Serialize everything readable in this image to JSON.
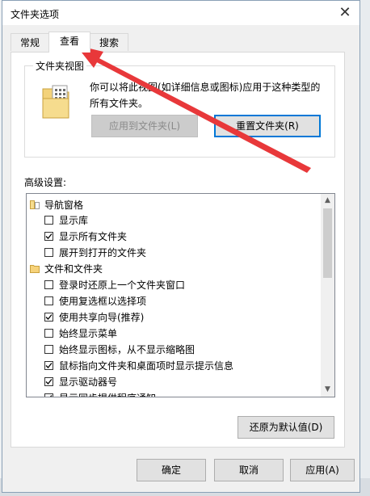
{
  "dialog": {
    "title": "文件夹选项",
    "close_glyph": "✕"
  },
  "tabs": [
    {
      "label": "常规",
      "active": false
    },
    {
      "label": "查看",
      "active": true
    },
    {
      "label": "搜索",
      "active": false
    }
  ],
  "folder_views": {
    "legend": "文件夹视图",
    "description": "你可以将此视图(如详细信息或图标)应用于这种类型的所有文件夹。",
    "apply_button": "应用到文件夹(L)",
    "reset_button": "重置文件夹(R)"
  },
  "advanced": {
    "label": "高级设置:",
    "items": [
      {
        "type": "folder",
        "label": "导航窗格",
        "indent": 0
      },
      {
        "type": "checkbox",
        "label": "显示库",
        "checked": false,
        "indent": 1
      },
      {
        "type": "checkbox",
        "label": "显示所有文件夹",
        "checked": true,
        "indent": 1
      },
      {
        "type": "checkbox",
        "label": "展开到打开的文件夹",
        "checked": false,
        "indent": 1
      },
      {
        "type": "folder",
        "label": "文件和文件夹",
        "indent": 0
      },
      {
        "type": "checkbox",
        "label": "登录时还原上一个文件夹窗口",
        "checked": false,
        "indent": 1
      },
      {
        "type": "checkbox",
        "label": "使用复选框以选择项",
        "checked": false,
        "indent": 1
      },
      {
        "type": "checkbox",
        "label": "使用共享向导(推荐)",
        "checked": true,
        "indent": 1
      },
      {
        "type": "checkbox",
        "label": "始终显示菜单",
        "checked": false,
        "indent": 1
      },
      {
        "type": "checkbox",
        "label": "始终显示图标，从不显示缩略图",
        "checked": false,
        "indent": 1
      },
      {
        "type": "checkbox",
        "label": "鼠标指向文件夹和桌面项时显示提示信息",
        "checked": true,
        "indent": 1
      },
      {
        "type": "checkbox",
        "label": "显示驱动器号",
        "checked": true,
        "indent": 1
      },
      {
        "type": "checkbox",
        "label": "显示同步提供程序通知",
        "checked": true,
        "indent": 1
      }
    ],
    "restore_button": "还原为默认值(D)"
  },
  "footer": {
    "ok_button": "确定",
    "cancel_button": "取消",
    "apply_button": "应用(A)"
  },
  "colors": {
    "annotation_arrow": "#e8383a",
    "accent": "#0078d7"
  }
}
